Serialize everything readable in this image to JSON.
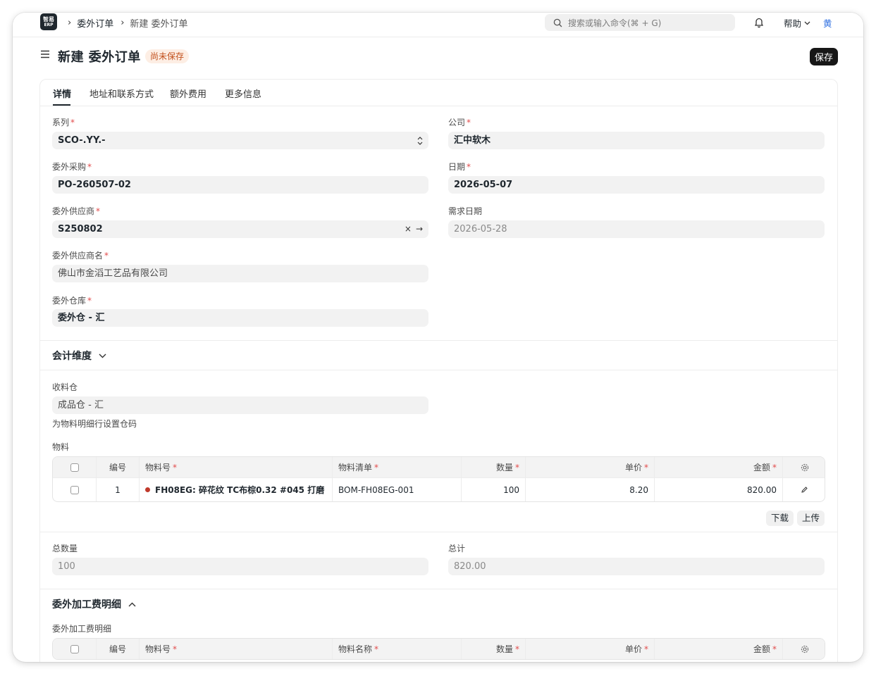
{
  "app": {
    "logo_line1": "智易",
    "logo_line2": "ERP"
  },
  "breadcrumb": {
    "parent": "委外订单",
    "current": "新建 委外订单"
  },
  "search": {
    "placeholder": "搜索或输入命令(⌘ + G)"
  },
  "nav": {
    "help_label": "帮助",
    "user_initial": "黄"
  },
  "page": {
    "title": "新建 委外订单",
    "status": "尚未保存",
    "save_label": "保存"
  },
  "tabs": [
    {
      "label": "详情"
    },
    {
      "label": "地址和联系方式"
    },
    {
      "label": "额外费用"
    },
    {
      "label": "更多信息"
    }
  ],
  "form": {
    "series": {
      "label": "系列",
      "value": "SCO-.YY.-"
    },
    "company": {
      "label": "公司",
      "value": "汇中软木"
    },
    "purchase_order": {
      "label": "委外采购",
      "value": "PO-260507-02"
    },
    "date": {
      "label": "日期",
      "value": "2026-05-07"
    },
    "supplier": {
      "label": "委外供应商",
      "value": "S250802"
    },
    "schedule_date": {
      "label": "需求日期",
      "value": "2026-05-28"
    },
    "supplier_name": {
      "label": "委外供应商名",
      "value": "佛山市金滔工艺品有限公司"
    },
    "supplier_warehouse": {
      "label": "委外仓库",
      "value": "委外仓 - 汇"
    }
  },
  "accounting": {
    "title": "会计维度"
  },
  "receipt": {
    "warehouse_label": "收料仓",
    "warehouse_value": "成品仓 - 汇",
    "set_warehouse_link": "为物料明细行设置仓码",
    "items_label": "物料"
  },
  "items_table": {
    "headers": {
      "no": "编号",
      "item_code": "物料号",
      "bom": "物料清单",
      "qty": "数量",
      "rate": "单价",
      "amount": "金额"
    },
    "rows": [
      {
        "no": "1",
        "item_code": "FH08EG: 碎花纹 TC布棕0.32 #045 打磨",
        "bom": "BOM-FH08EG-001",
        "qty": "100",
        "rate": "8.20",
        "amount": "820.00"
      }
    ],
    "download_label": "下载",
    "upload_label": "上传"
  },
  "totals": {
    "qty_label": "总数量",
    "qty_value": "100",
    "total_label": "总计",
    "total_value": "820.00"
  },
  "service": {
    "section_title": "委外加工费明细",
    "table_label": "委外加工费明细",
    "headers": {
      "no": "编号",
      "item_code": "物料号",
      "item_name": "物料名称",
      "qty": "数量",
      "rate": "单价",
      "amount": "金额"
    }
  },
  "colors": {
    "status_badge_bg": "#fdeee4",
    "status_badge_text": "#c2501c",
    "required": "#e24c4c",
    "primary_button": "#171717",
    "user_accent": "#2f6fe0"
  }
}
